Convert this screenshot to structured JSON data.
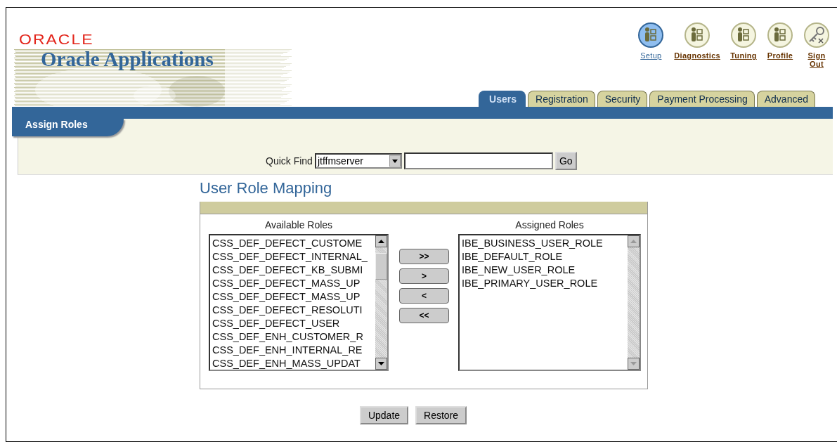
{
  "header": {
    "logo": "ORACLE",
    "product": "Oracle Applications"
  },
  "global_links": [
    {
      "label": "Setup",
      "kind": "person",
      "selected": true
    },
    {
      "label": "Diagnostics",
      "kind": "person",
      "selected": false
    },
    {
      "label": "Tuning",
      "kind": "person",
      "selected": false
    },
    {
      "label": "Profile",
      "kind": "person",
      "selected": false
    },
    {
      "label": "Sign Out",
      "kind": "key",
      "selected": false
    }
  ],
  "tabs": [
    {
      "label": "Users",
      "selected": true
    },
    {
      "label": "Registration",
      "selected": false
    },
    {
      "label": "Security",
      "selected": false
    },
    {
      "label": "Payment Processing",
      "selected": false
    },
    {
      "label": "Advanced",
      "selected": false
    }
  ],
  "subtab": {
    "label": "Assign Roles"
  },
  "quick_find": {
    "label": "Quick Find",
    "select_value": "jtffmserver",
    "button": "Go"
  },
  "section_title": "User Role Mapping",
  "available": {
    "heading": "Available Roles",
    "scroll_enabled": true,
    "items": [
      "CSS_DEF_DEFECT_CUSTOME",
      "CSS_DEF_DEFECT_INTERNAL_",
      "CSS_DEF_DEFECT_KB_SUBMI",
      "CSS_DEF_DEFECT_MASS_UP",
      "CSS_DEF_DEFECT_MASS_UP",
      "CSS_DEF_DEFECT_RESOLUTI",
      "CSS_DEF_DEFECT_USER",
      "CSS_DEF_ENH_CUSTOMER_R",
      "CSS_DEF_ENH_INTERNAL_RE",
      "CSS_DEF_ENH_MASS_UPDAT"
    ]
  },
  "move_buttons": [
    ">>",
    ">",
    "<",
    "<<"
  ],
  "assigned": {
    "heading": "Assigned Roles",
    "scroll_enabled": false,
    "items": [
      "IBE_BUSINESS_USER_ROLE",
      "IBE_DEFAULT_ROLE",
      "IBE_NEW_USER_ROLE",
      "IBE_PRIMARY_USER_ROLE"
    ]
  },
  "actions": [
    "Update",
    "Restore"
  ]
}
